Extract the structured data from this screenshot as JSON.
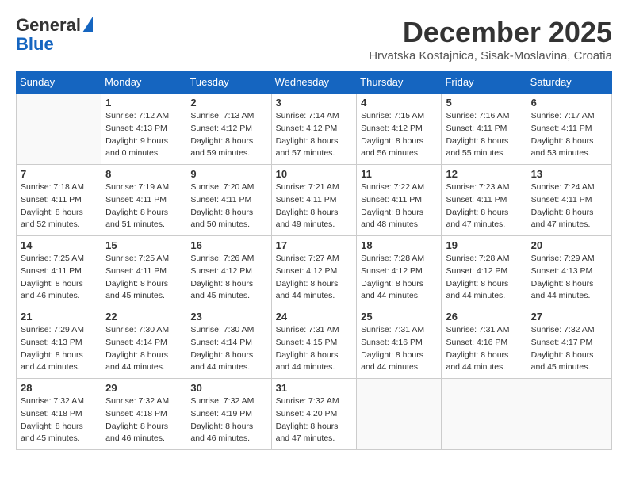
{
  "logo": {
    "line1": "General",
    "line2": "Blue"
  },
  "title": "December 2025",
  "subtitle": "Hrvatska Kostajnica, Sisak-Moslavina, Croatia",
  "days_of_week": [
    "Sunday",
    "Monday",
    "Tuesday",
    "Wednesday",
    "Thursday",
    "Friday",
    "Saturday"
  ],
  "weeks": [
    [
      {
        "day": "",
        "sunrise": "",
        "sunset": "",
        "daylight": ""
      },
      {
        "day": "1",
        "sunrise": "7:12 AM",
        "sunset": "4:13 PM",
        "daylight": "9 hours and 0 minutes."
      },
      {
        "day": "2",
        "sunrise": "7:13 AM",
        "sunset": "4:12 PM",
        "daylight": "8 hours and 59 minutes."
      },
      {
        "day": "3",
        "sunrise": "7:14 AM",
        "sunset": "4:12 PM",
        "daylight": "8 hours and 57 minutes."
      },
      {
        "day": "4",
        "sunrise": "7:15 AM",
        "sunset": "4:12 PM",
        "daylight": "8 hours and 56 minutes."
      },
      {
        "day": "5",
        "sunrise": "7:16 AM",
        "sunset": "4:11 PM",
        "daylight": "8 hours and 55 minutes."
      },
      {
        "day": "6",
        "sunrise": "7:17 AM",
        "sunset": "4:11 PM",
        "daylight": "8 hours and 53 minutes."
      }
    ],
    [
      {
        "day": "7",
        "sunrise": "7:18 AM",
        "sunset": "4:11 PM",
        "daylight": "8 hours and 52 minutes."
      },
      {
        "day": "8",
        "sunrise": "7:19 AM",
        "sunset": "4:11 PM",
        "daylight": "8 hours and 51 minutes."
      },
      {
        "day": "9",
        "sunrise": "7:20 AM",
        "sunset": "4:11 PM",
        "daylight": "8 hours and 50 minutes."
      },
      {
        "day": "10",
        "sunrise": "7:21 AM",
        "sunset": "4:11 PM",
        "daylight": "8 hours and 49 minutes."
      },
      {
        "day": "11",
        "sunrise": "7:22 AM",
        "sunset": "4:11 PM",
        "daylight": "8 hours and 48 minutes."
      },
      {
        "day": "12",
        "sunrise": "7:23 AM",
        "sunset": "4:11 PM",
        "daylight": "8 hours and 47 minutes."
      },
      {
        "day": "13",
        "sunrise": "7:24 AM",
        "sunset": "4:11 PM",
        "daylight": "8 hours and 47 minutes."
      }
    ],
    [
      {
        "day": "14",
        "sunrise": "7:25 AM",
        "sunset": "4:11 PM",
        "daylight": "8 hours and 46 minutes."
      },
      {
        "day": "15",
        "sunrise": "7:25 AM",
        "sunset": "4:11 PM",
        "daylight": "8 hours and 45 minutes."
      },
      {
        "day": "16",
        "sunrise": "7:26 AM",
        "sunset": "4:12 PM",
        "daylight": "8 hours and 45 minutes."
      },
      {
        "day": "17",
        "sunrise": "7:27 AM",
        "sunset": "4:12 PM",
        "daylight": "8 hours and 44 minutes."
      },
      {
        "day": "18",
        "sunrise": "7:28 AM",
        "sunset": "4:12 PM",
        "daylight": "8 hours and 44 minutes."
      },
      {
        "day": "19",
        "sunrise": "7:28 AM",
        "sunset": "4:12 PM",
        "daylight": "8 hours and 44 minutes."
      },
      {
        "day": "20",
        "sunrise": "7:29 AM",
        "sunset": "4:13 PM",
        "daylight": "8 hours and 44 minutes."
      }
    ],
    [
      {
        "day": "21",
        "sunrise": "7:29 AM",
        "sunset": "4:13 PM",
        "daylight": "8 hours and 44 minutes."
      },
      {
        "day": "22",
        "sunrise": "7:30 AM",
        "sunset": "4:14 PM",
        "daylight": "8 hours and 44 minutes."
      },
      {
        "day": "23",
        "sunrise": "7:30 AM",
        "sunset": "4:14 PM",
        "daylight": "8 hours and 44 minutes."
      },
      {
        "day": "24",
        "sunrise": "7:31 AM",
        "sunset": "4:15 PM",
        "daylight": "8 hours and 44 minutes."
      },
      {
        "day": "25",
        "sunrise": "7:31 AM",
        "sunset": "4:16 PM",
        "daylight": "8 hours and 44 minutes."
      },
      {
        "day": "26",
        "sunrise": "7:31 AM",
        "sunset": "4:16 PM",
        "daylight": "8 hours and 44 minutes."
      },
      {
        "day": "27",
        "sunrise": "7:32 AM",
        "sunset": "4:17 PM",
        "daylight": "8 hours and 45 minutes."
      }
    ],
    [
      {
        "day": "28",
        "sunrise": "7:32 AM",
        "sunset": "4:18 PM",
        "daylight": "8 hours and 45 minutes."
      },
      {
        "day": "29",
        "sunrise": "7:32 AM",
        "sunset": "4:18 PM",
        "daylight": "8 hours and 46 minutes."
      },
      {
        "day": "30",
        "sunrise": "7:32 AM",
        "sunset": "4:19 PM",
        "daylight": "8 hours and 46 minutes."
      },
      {
        "day": "31",
        "sunrise": "7:32 AM",
        "sunset": "4:20 PM",
        "daylight": "8 hours and 47 minutes."
      },
      {
        "day": "",
        "sunrise": "",
        "sunset": "",
        "daylight": ""
      },
      {
        "day": "",
        "sunrise": "",
        "sunset": "",
        "daylight": ""
      },
      {
        "day": "",
        "sunrise": "",
        "sunset": "",
        "daylight": ""
      }
    ]
  ]
}
